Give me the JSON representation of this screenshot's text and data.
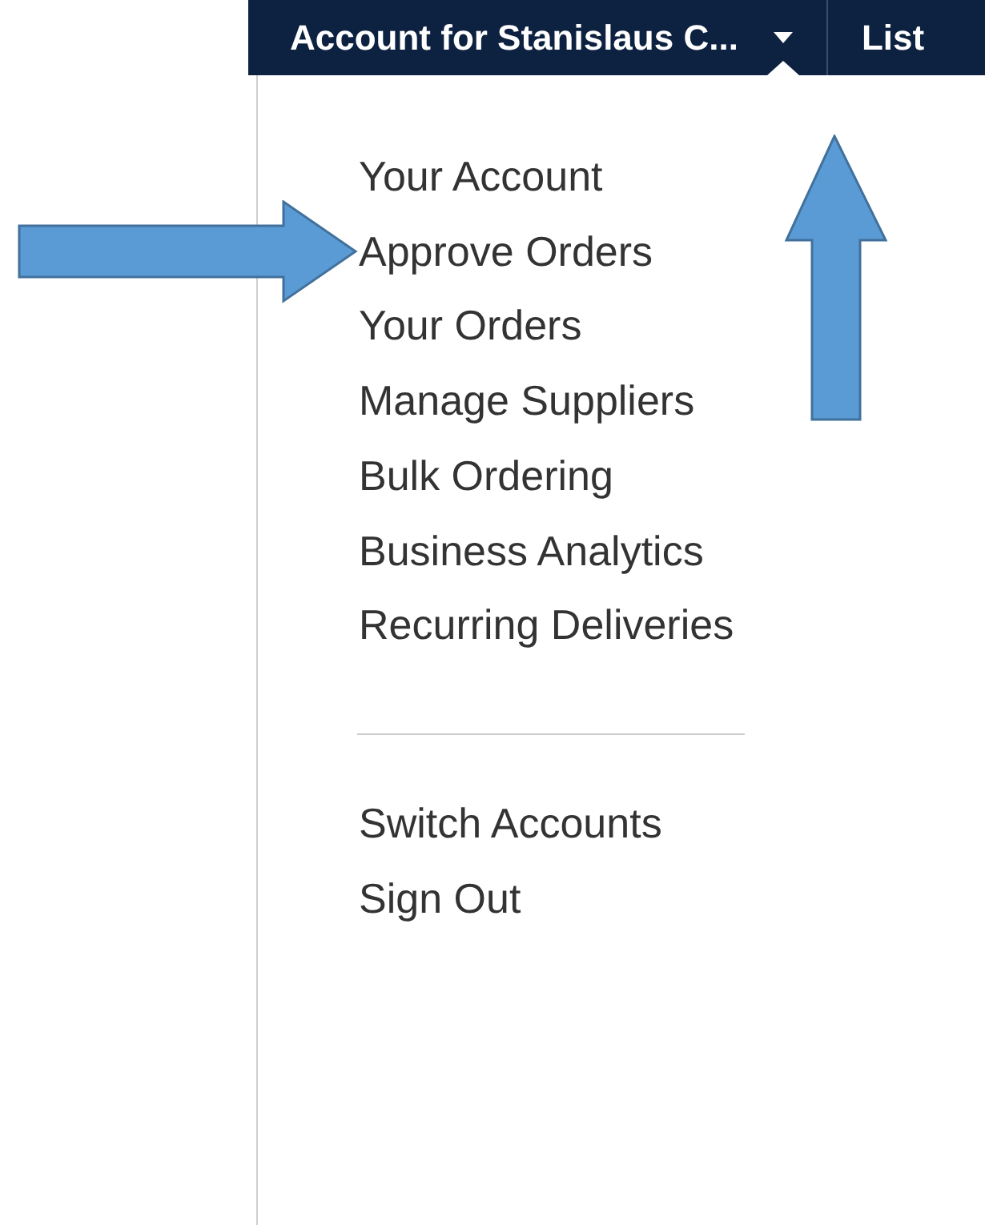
{
  "nav": {
    "account_menu": {
      "label": "Account for Stanislaus C...",
      "expanded": true
    },
    "next_item": "List"
  },
  "menu": {
    "groups": [
      {
        "items": [
          "Your Account",
          "Approve Orders",
          "Your Orders",
          "Manage Suppliers",
          "Bulk Ordering",
          "Business Analytics",
          "Recurring Deliveries"
        ]
      },
      {
        "items": [
          "Switch Accounts",
          "Sign Out"
        ]
      }
    ]
  }
}
